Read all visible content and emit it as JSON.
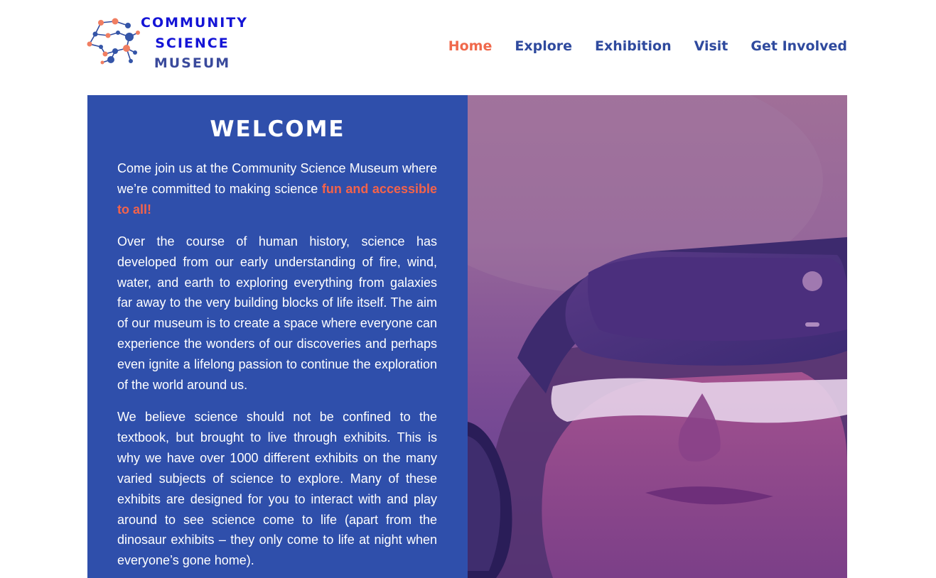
{
  "brand": {
    "line1": "COMMUNITY",
    "line2": "SCIENCE",
    "line3": "MUSEUM"
  },
  "nav": {
    "items": [
      "Home",
      "Explore",
      "Exhibition",
      "Visit",
      "Get Involved"
    ],
    "active": "Home"
  },
  "colors": {
    "brand_blue": "#2f4fab",
    "accent_coral": "#f0694c",
    "nav_blue": "#2f4a9e",
    "logo_blue": "#1414d6"
  },
  "welcome": {
    "title": "WELCOME",
    "p1_start": "Come join us at the Community Science Museum where we’re committed to making science ",
    "p1_highlight": "fun and accessible to all!",
    "p2": "Over the course of human history, science has developed from our early understanding of fire, wind, water, and earth to exploring everything from galaxies far away to the very building blocks of life itself. The aim of our museum is to create a space where everyone can experience the wonders of our discoveries and perhaps even ignite a lifelong passion to continue the exploration of the world around us.",
    "p3": "We believe science should not be confined to the textbook, but brought to live through exhibits. This is why we have over 1000 different exhibits on the many varied subjects of science to explore. Many of these exhibits are designed for you to interact with and play around to see science come to life (apart from the dinosaur exhibits – they only come to life at night when everyone’s gone home)."
  },
  "hero_image": {
    "icon": "vr-headset-photo"
  }
}
